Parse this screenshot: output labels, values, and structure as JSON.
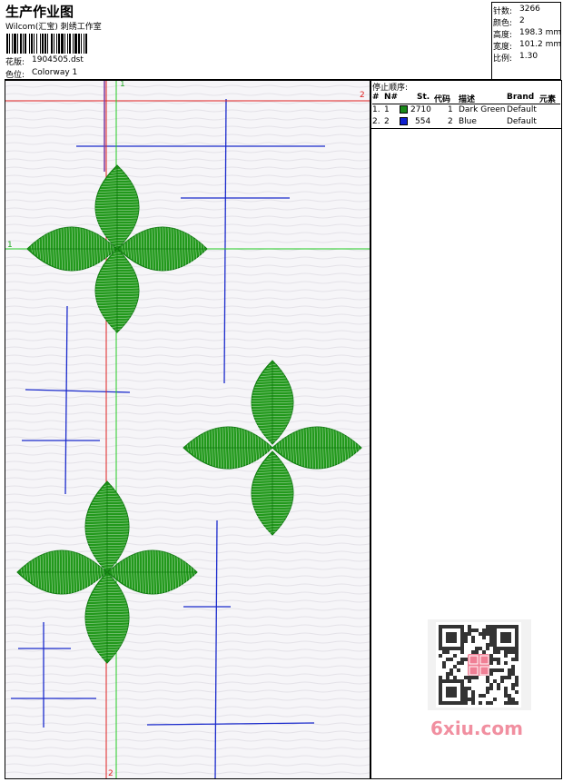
{
  "header": {
    "title": "生产作业图",
    "company": "Wilcom(汇宝) 刺绣工作室",
    "design_label": "花版:",
    "design_value": "1904505.dst",
    "colorway_label": "色位:",
    "colorway_value": "Colorway 1"
  },
  "stats": [
    {
      "label": "针数:",
      "value": "3266"
    },
    {
      "label": "颜色:",
      "value": "2"
    },
    {
      "label": "高度:",
      "value": "198.3 mm"
    },
    {
      "label": "宽度:",
      "value": "101.2 mm"
    },
    {
      "label": "比例:",
      "value": "1.30"
    }
  ],
  "stop_sequence": {
    "title": "停止顺序:",
    "columns": [
      "#",
      "N#",
      "St.",
      "代码",
      "描述",
      "Brand",
      "元素"
    ],
    "rows": [
      {
        "num": "1.",
        "n": "1",
        "color": "#1a8a1a",
        "st": "2710",
        "code": "1",
        "desc": "Dark Green",
        "brand": "Default"
      },
      {
        "num": "2.",
        "n": "2",
        "color": "#1020d0",
        "st": "554",
        "code": "2",
        "desc": "Blue",
        "brand": "Default"
      }
    ]
  },
  "markers": {
    "h1": "1",
    "v1": "1",
    "h2": "2",
    "v2": "2"
  },
  "watermark": "6xiu.com",
  "colors": {
    "leaf": "#22991c",
    "leaf_dark": "#0f7a0f",
    "stitch_line": "#1a2acc",
    "guide_red": "#e02020",
    "guide_green": "#22cc22"
  }
}
